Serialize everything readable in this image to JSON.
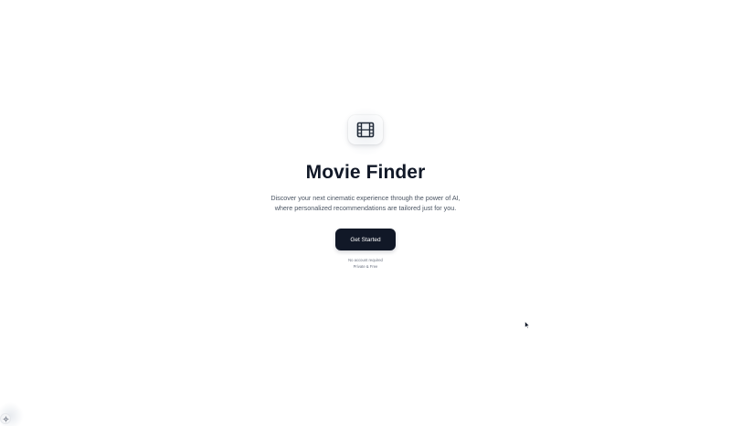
{
  "hero": {
    "logo_icon": "film-icon",
    "title": "Movie Finder",
    "subtitle_line1": "Discover your next cinematic experience through the power of AI,",
    "subtitle_line2": "where personalized recommendations are tailored just for you.",
    "cta_label": "Get Started",
    "note_line1": "No account required",
    "note_line2": "Private & Free"
  },
  "colors": {
    "primary": "#111827",
    "muted_text": "#4b5563",
    "background": "#ffffff"
  },
  "corner_widget": {
    "icon": "settings-icon"
  }
}
